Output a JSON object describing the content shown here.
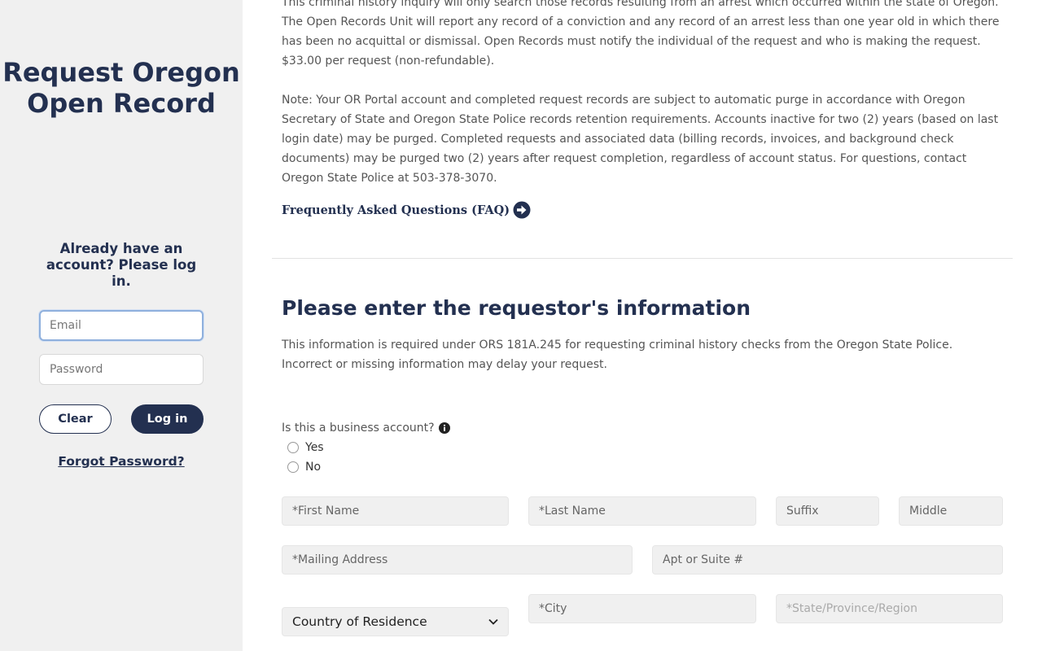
{
  "sidebar": {
    "title": "Request Oregon Open Record",
    "login_heading": "Already have an account? Please log in.",
    "email_placeholder": "Email",
    "password_placeholder": "Password",
    "clear_label": "Clear",
    "login_label": "Log in",
    "forgot_label": "Forgot Password?"
  },
  "main": {
    "intro_text": "This criminal history inquiry will only search those records resulting from an arrest which occurred within the state of Oregon. The Open Records Unit will report any record of a conviction and any record of an arrest less than one year old in which there has been no acquittal or dismissal. Open Records must notify the individual of the request and who is making the request. $33.00 per request (non-refundable).",
    "note_text": "Note: Your OR Portal account and completed request records are subject to automatic purge in accordance with Oregon Secretary of State and Oregon State Police records retention requirements. Accounts inactive for two (2) years (based on last login date) may be purged. Completed requests and associated data (billing records, invoices, and background check documents) may be purged two (2) years after request completion, regardless of account status. For questions, contact Oregon State Police at 503-378-3070.",
    "faq_label": "Frequently Asked Questions (FAQ)",
    "section_title": "Please enter the requestor's information",
    "info_text": "This information is required under ORS 181A.245 for requesting criminal history checks from the Oregon State Police. Incorrect or missing information may delay your request.",
    "business_question": "Is this a business account?",
    "radio_yes": "Yes",
    "radio_no": "No"
  },
  "form": {
    "first_name": "*First Name",
    "last_name": "*Last Name",
    "suffix": "Suffix",
    "middle": "Middle",
    "mailing_address": "*Mailing Address",
    "apt": "Apt or Suite #",
    "country": "Country of Residence",
    "city": "*City",
    "state": "*State/Province/Region"
  },
  "icons": {
    "faq_icon": "arrow-right-circle-icon",
    "info_icon": "info-icon",
    "dropdown_icon": "chevron-down-icon"
  },
  "colors": {
    "brand_navy": "#233050",
    "sidebar_bg": "#f0f0f0",
    "field_bg": "#f0f0f0"
  }
}
